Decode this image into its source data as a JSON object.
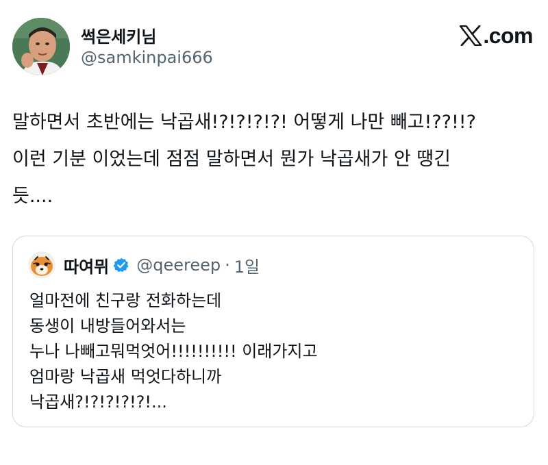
{
  "author": {
    "display_name": "썩은세키님",
    "handle": "@samkinpai666",
    "avatar_icon": "profile-photo"
  },
  "site": {
    "logo_icon": "x-logo-icon",
    "domain_text": ".com"
  },
  "tweet": {
    "lines": [
      "말하면서 초반에는 낙곱새!?!?!?!?! 어떻게 나만 빼고!??!!?",
      "이런 기분 이었는데 점점 말하면서 뭔가 낙곱새가 안 땡긴",
      "듯...."
    ]
  },
  "quoted_tweet": {
    "display_name": "따여뮈",
    "verified": true,
    "verified_color": "#1d9bf0",
    "handle": "@qeereep",
    "separator": "·",
    "time": "1일",
    "lines": [
      "얼마전에 친구랑 전화하는데",
      "동생이 내방들어와서는",
      "누나 나빼고뭐먹엇어!!!!!!!!!! 이래가지고",
      "엄마랑 낙곱새 먹엇다하니까",
      "낙곱새?!?!?!?!?!..."
    ]
  },
  "colors": {
    "text_primary": "#0f1419",
    "text_secondary": "#536471",
    "border": "#cfd9de",
    "background": "#ffffff"
  }
}
